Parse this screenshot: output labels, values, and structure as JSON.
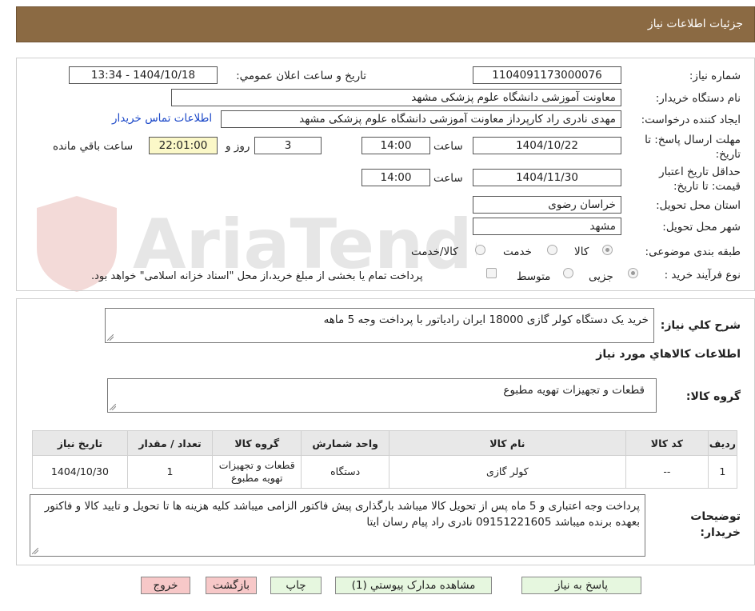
{
  "header": {
    "title": "جزئیات اطلاعات نیاز"
  },
  "watermark": {
    "text": "AriaTender.neT"
  },
  "need": {
    "number_label": "شماره نیاز:",
    "number_value": "1104091173000076",
    "announce_label": "تاریخ و ساعت اعلان عمومي:",
    "announce_value": "1404/10/18 - 13:34",
    "buyer_label": "نام دستگاه خریدار:",
    "buyer_value": "معاونت آموزشی دانشگاه علوم پزشکی مشهد",
    "creator_label": "ایجاد کننده درخواست:",
    "creator_value": "مهدی نادری راد کارپرداز معاونت آموزشی دانشگاه علوم پزشکی مشهد",
    "contact_link": "اطلاعات تماس خریدار",
    "deadline_label_1": "مهلت ارسال پاسخ: تا",
    "deadline_label_2": "تاریخ:",
    "deadline_date": "1404/10/22",
    "time_label": "ساعت",
    "deadline_time": "14:00",
    "days_value": "3",
    "days_label": "روز و",
    "remaining_value": "22:01:00",
    "remaining_label": "ساعت باقي مانده",
    "validity_label_1": "حداقل تاریخ اعتبار",
    "validity_label_2": "قیمت: تا تاریخ:",
    "validity_date": "1404/11/30",
    "validity_time": "14:00",
    "province_label": "استان محل تحویل:",
    "province_value": "خراسان رضوی",
    "city_label": "شهر محل تحویل:",
    "city_value": "مشهد",
    "category_label": "طبقه بندی موضوعی:",
    "category_options": [
      "کالا",
      "خدمت",
      "کالا/خدمت"
    ],
    "category_selected": "کالا",
    "process_label": "نوع فرآیند خرید :",
    "process_options": [
      "جزیی",
      "متوسط"
    ],
    "process_selected": "جزیی",
    "payment_note": "پرداخت تمام یا بخشی از مبلغ خرید،از محل \"اسناد خزانه اسلامی\" خواهد بود."
  },
  "details": {
    "summary_label": "شرح کلي نیاز:",
    "summary_value": "خرید یک دستگاه کولر گازی 18000 ایران رادیاتور با پرداخت وجه 5 ماهه",
    "goods_info_title": "اطلاعات کالاهاي مورد نیاز",
    "goods_group_label": "گروه کالا:",
    "goods_group_value": "قطعات و تجهیزات تهویه مطبوع",
    "table": {
      "headers": [
        "ردیف",
        "کد کالا",
        "نام کالا",
        "واحد شمارش",
        "گروه کالا",
        "تعداد / مقدار",
        "تاریخ نیاز"
      ],
      "rows": [
        [
          "1",
          "--",
          "کولر گازی",
          "دستگاه",
          "قطعات و تجهیزات تهویه مطبوع",
          "1",
          "1404/10/30"
        ]
      ]
    },
    "buyer_notes_label": "توضیحات خریدار:",
    "buyer_notes_value": "پرداخت وجه اعتباری و 5 ماه پس از تحویل کالا میباشد بارگذاری پیش فاکتور الزامی میباشد کلیه هزینه ها تا تحویل و تایید کالا و فاکتور بعهده برنده میباشد 09151221605 نادری راد پیام رسان ایتا"
  },
  "actions": {
    "reply": "پاسخ به نیاز",
    "attachments": "مشاهده مدارک پیوستي (1)",
    "print": "چاپ",
    "back": "بازگشت",
    "exit": "خروج"
  }
}
